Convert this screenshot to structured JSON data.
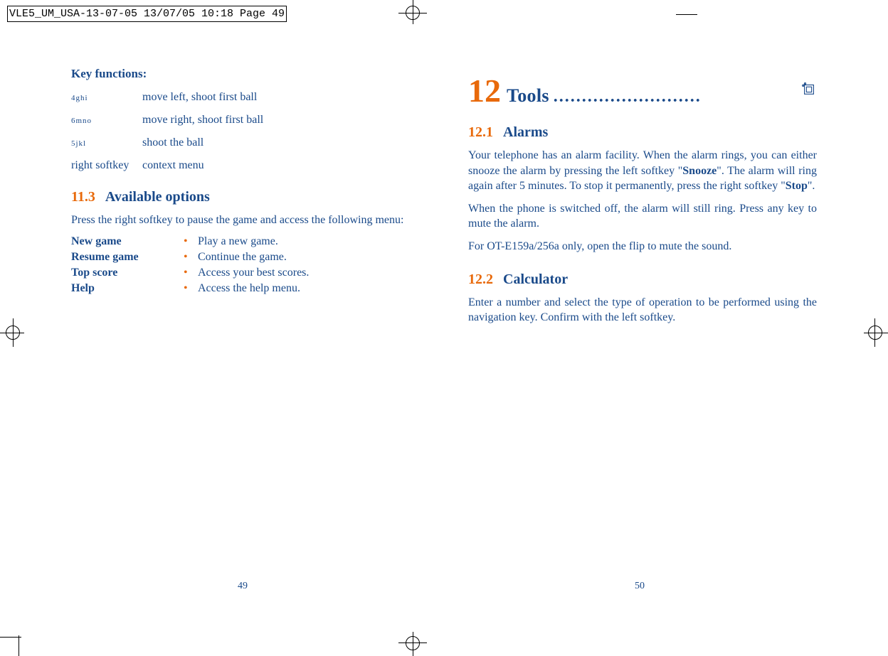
{
  "header": "VLE5_UM_USA-13-07-05  13/07/05  10:18  Page 49",
  "left": {
    "key_functions_heading": "Key functions:",
    "keys": [
      {
        "icon": "4ghi",
        "desc": "move left, shoot first ball"
      },
      {
        "icon": "6mno",
        "desc": "move right, shoot first ball"
      },
      {
        "icon": "5jkl",
        "desc": "shoot the ball"
      },
      {
        "icon": "right softkey",
        "desc": "context menu"
      }
    ],
    "section_num": "11.3",
    "section_title": "Available options",
    "section_intro": "Press the right softkey to pause the game and access the following menu:",
    "options": [
      {
        "name": "New game",
        "desc": "Play a new game."
      },
      {
        "name": "Resume game",
        "desc": "Continue the game."
      },
      {
        "name": "Top score",
        "desc": "Access your best scores."
      },
      {
        "name": "Help",
        "desc": "Access the help menu."
      }
    ],
    "page_num": "49"
  },
  "right": {
    "chapter_num": "12",
    "chapter_title": "Tools",
    "sections": [
      {
        "num": "12.1",
        "title": "Alarms",
        "paras": [
          {
            "pre": "Your telephone has an alarm facility. When the alarm rings, you can either snooze the alarm by pressing the left softkey \"",
            "b1": "Snooze",
            "mid": "\". The alarm will ring again after 5 minutes. To stop it permanently, press the right softkey \"",
            "b2": "Stop",
            "post": "\"."
          },
          {
            "text": "When the phone is switched off, the alarm will still ring. Press any key to mute the alarm."
          },
          {
            "text": "For OT-E159a/256a only, open the flip to mute the sound."
          }
        ]
      },
      {
        "num": "12.2",
        "title": "Calculator",
        "paras": [
          {
            "text": "Enter a number and select the type of operation to be performed using the navigation key. Confirm with the left softkey."
          }
        ]
      }
    ],
    "page_num": "50"
  }
}
